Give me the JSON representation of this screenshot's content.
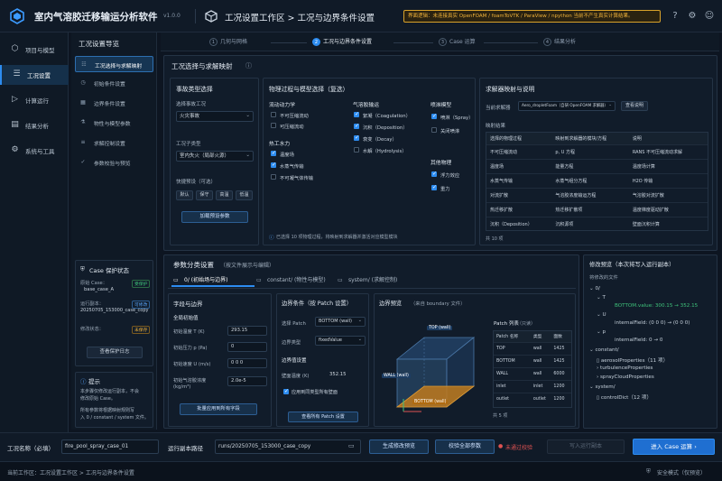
{
  "app": {
    "title": "室内气溶胶迁移输运分析软件",
    "version": "v1.0.0",
    "breadcrumb": "工况设置工作区  >  工况与边界条件设置",
    "warning": "界面逻辑：未连接真实 OpenFOAM / foamToVTK / ParaView / npython 当前不产生真实计算结果。"
  },
  "sidebar": {
    "items": [
      {
        "label": "项目与模型",
        "icon": "cube-icon"
      },
      {
        "label": "工况设置",
        "icon": "sliders-icon"
      },
      {
        "label": "计算运行",
        "icon": "play-icon"
      },
      {
        "label": "结果分析",
        "icon": "chart-icon"
      },
      {
        "label": "系统与工具",
        "icon": "gear-icon"
      }
    ]
  },
  "nav": {
    "title": "工况设置导览",
    "items": [
      "工况选择与求解映射",
      "初始条件设置",
      "边界条件设置",
      "物性与模型参数",
      "求解控制设置",
      "参数校验与预览"
    ]
  },
  "case_status": {
    "title": "Case 保护状态",
    "base_label": "原始 Case：",
    "base_value": "base_case_A",
    "base_badge": "受保护",
    "copy_label": "运行副本：",
    "copy_value": "20250705_153000_case_copy",
    "copy_badge": "可修改",
    "modify_label": "修改状态：",
    "modify_badge": "未保存",
    "log_button": "查看保护日志"
  },
  "tip": {
    "title": "提示",
    "lines": [
      "本步骤仅修改运行副本，不会",
      "修改原始 Case。",
      "所有参数将根据映射规则写",
      "入 0 / constant / system 文件。"
    ]
  },
  "steps": [
    {
      "num": "1",
      "label": "几何与网格"
    },
    {
      "num": "2",
      "label": "工况与边界条件设置"
    },
    {
      "num": "3",
      "label": "Case 运算"
    },
    {
      "num": "4",
      "label": "结果分析"
    }
  ],
  "section1": {
    "title": "工况选择与求解映射"
  },
  "accident": {
    "title": "事故类型选择",
    "event_label": "选择事故工况",
    "event_value": "火灾事故",
    "source_label": "工况子类型",
    "source_value": "室内失火（局部火源）",
    "quick_label": "快捷预设（可选）",
    "presets": [
      "默认",
      "保守",
      "高温",
      "低温"
    ],
    "load_button": "加载预设参数"
  },
  "physics": {
    "title": "物理过程与模型选择（复选）",
    "flow_title": "流动动力学",
    "flow_items": [
      {
        "label": "不可压缩流动",
        "on": false
      },
      {
        "label": "可压缩流动",
        "on": false
      }
    ],
    "heat_title": "热工水力",
    "heat_items": [
      {
        "label": "温度场",
        "on": true
      },
      {
        "label": "水蒸气传输",
        "on": true
      },
      {
        "label": "不可凝气体传输",
        "on": false
      }
    ],
    "aerosol_title": "气溶胶输运",
    "aerosol_items": [
      {
        "label": "絮凝（Coagulation）",
        "on": true
      },
      {
        "label": "沉积（Deposition）",
        "on": true
      },
      {
        "label": "衰变（Decay）",
        "on": true
      },
      {
        "label": "水解（Hydrolysis）",
        "on": false
      }
    ],
    "spray_title": "喷淋模型",
    "spray_items": [
      {
        "label": "喷淋（Spray）",
        "on": true
      },
      {
        "label": "关闭喷淋",
        "on": false
      }
    ],
    "other_title": "其他物理",
    "other_items": [
      {
        "label": "浮力效应",
        "on": true
      },
      {
        "label": "重力",
        "on": true
      }
    ],
    "note": "已选择 10 项物理过程，将映射到求解器并激活对应模型模块"
  },
  "solver": {
    "title": "求解器映射与说明",
    "current_label": "当前求解器",
    "current_value": "Aero_dropletFoam（自研 OpenFOAM 求解器）",
    "view_button": "查看说明",
    "result_label": "映射结果",
    "headers": [
      "选择的物理过程",
      "映射到求解器的模块/方程",
      "说明"
    ],
    "rows": [
      [
        "不可压缩流动",
        "p, U 方程",
        "RANS 不可压缩流动求解"
      ],
      [
        "温度场",
        "能量方程",
        "温度场计算"
      ],
      [
        "水蒸气传输",
        "水蒸气组分方程",
        "H2O 传输"
      ],
      [
        "对流扩散",
        "气溶胶浓度输运方程",
        "气溶胶对流扩散"
      ],
      [
        "热迁移扩散",
        "热迁移扩散项",
        "温度梯度驱动扩散"
      ],
      [
        "沉积（Deposition）",
        "沉积源项",
        "壁面沉积计算"
      ]
    ],
    "count": "共 10 项"
  },
  "section2": {
    "title": "参数分类设置",
    "sub": "（按文件展示与编辑）"
  },
  "tabs": [
    "0/ (初始场与边界)",
    "constant/ (物性与模型)",
    "system/ (求解控制)"
  ],
  "fields": {
    "title": "字段与边界",
    "init_title": "全局初始值",
    "rows": [
      {
        "label": "初始温度 T (K)",
        "value": "293.15"
      },
      {
        "label": "初始压力 p (Pa)",
        "value": "0"
      },
      {
        "label": "初始速度 U (m/s)",
        "value": "0     0     0"
      },
      {
        "label": "初始气溶胶浓度",
        "value": "2.0e-5"
      }
    ],
    "unit": "(kg/m³)",
    "apply_button": "批量应用到所有字段"
  },
  "boundary": {
    "title": "边界条件（按 Patch 设置）",
    "patch_label": "选择 Patch",
    "patch_value": "BOTTOM (wall)",
    "type_label": "边界类型",
    "type_value": "fixedValue",
    "value_title": "边界值设置",
    "wall_label": "壁面温度 (K)",
    "wall_value": "352.15",
    "same_label": "应用到同类型所有壁面",
    "all_button": "查看所有 Patch 设置"
  },
  "preview": {
    "title": "边界预览",
    "sub": "（来自 boundary 文件）",
    "labels": [
      "TOP (wall)",
      "WALL (wall)",
      "BOTTOM (wall)"
    ],
    "patch_title": "Patch 列表",
    "patch_sub": "（只读）",
    "headers": [
      "Patch 名称",
      "类型",
      "面数"
    ],
    "rows": [
      [
        "TOP",
        "wall",
        "1425"
      ],
      [
        "BOTTOM",
        "wall",
        "1425"
      ],
      [
        "WALL",
        "wall",
        "6000"
      ],
      [
        "inlet",
        "inlet",
        "1200"
      ],
      [
        "outlet",
        "outlet",
        "1200"
      ]
    ],
    "count": "共 5 项"
  },
  "mods": {
    "title": "修改预览（本次将写入运行副本）",
    "sub": "将修改的文件",
    "tree": [
      "0/",
      "T",
      "BOTTOM.value: 300.15 → 352.15",
      "U",
      "internalField: (0 0 0) → (0 0 0)",
      "p",
      "internalField: 0 → 0",
      "constant/",
      "aerosolProperties（11 项）",
      "turbulenceProperties",
      "sprayCloudProperties",
      "system/",
      "controlDict（12 项）"
    ]
  },
  "bottom": {
    "case_label": "工况名称（必填）",
    "case_value": "fire_pool_spray_case_01",
    "path_label": "运行副本路径",
    "path_value": "runs/20250705_153000_case_copy",
    "gen_button": "生成修改预览",
    "check_button": "校验全部参数",
    "check_status": "未通过校验",
    "write_button": "写入运行副本",
    "next_button": "进入 Case 运算  ›"
  },
  "status": {
    "left": "当前工作区：工况设置工作区  >  工况与边界条件设置",
    "right": "安全模式（仅预览）"
  },
  "colors": {
    "accent": "#2d8cf0",
    "warn": "#f0b23a",
    "ok": "#3ec17a",
    "error": "#e05252"
  }
}
